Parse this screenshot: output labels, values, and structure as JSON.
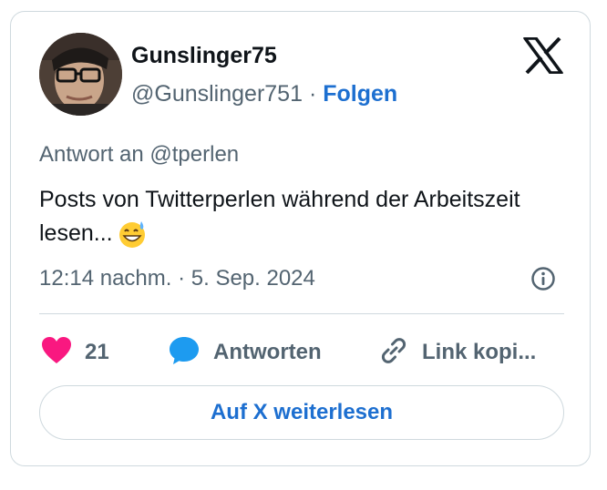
{
  "author": {
    "name": "Gunslinger75",
    "handle": "@Gunslinger751",
    "separator": "·",
    "follow_label": "Folgen"
  },
  "post": {
    "reply_to": "Antwort an @tperlen",
    "text": "Posts von Twitterperlen während der Arbeitszeit lesen...",
    "timestamp": "12:14 nachm. · 5. Sep. 2024"
  },
  "actions": {
    "like_count": "21",
    "reply_label": "Antworten",
    "link_label": "Link kopi..."
  },
  "read_more_label": "Auf X weiterlesen",
  "icons": {
    "x_logo": "x-logo-icon",
    "like": "heart-icon",
    "reply": "speech-bubble-icon",
    "link": "link-icon",
    "info": "info-icon",
    "emoji": "grinning-face-with-sweat-emoji"
  },
  "colors": {
    "link_blue": "#1d6fd0",
    "heart": "#f91880",
    "reply_blue": "#1d9bf0",
    "muted": "#536471",
    "border": "#cfd9de"
  }
}
